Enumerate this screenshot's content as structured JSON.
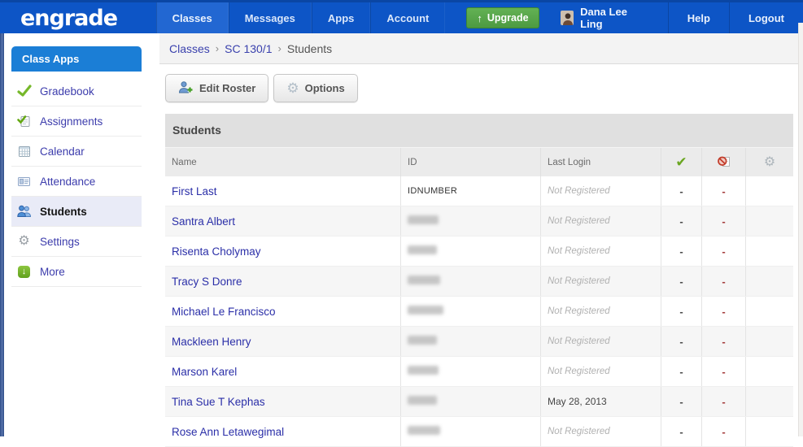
{
  "nav": {
    "logo": "engrade",
    "items": [
      {
        "label": "Classes",
        "active": true
      },
      {
        "label": "Messages",
        "active": false
      },
      {
        "label": "Apps",
        "active": false
      },
      {
        "label": "Account",
        "active": false
      }
    ],
    "upgrade_label": "Upgrade",
    "user_name": "Dana Lee Ling",
    "help_label": "Help",
    "logout_label": "Logout"
  },
  "sidebar": {
    "header": "Class Apps",
    "items": [
      {
        "label": "Gradebook",
        "icon": "gradebook-check-icon",
        "active": false
      },
      {
        "label": "Assignments",
        "icon": "assignments-icon",
        "active": false
      },
      {
        "label": "Calendar",
        "icon": "calendar-icon",
        "active": false
      },
      {
        "label": "Attendance",
        "icon": "attendance-icon",
        "active": false
      },
      {
        "label": "Students",
        "icon": "students-icon",
        "active": true
      },
      {
        "label": "Settings",
        "icon": "settings-gear-icon",
        "active": false
      },
      {
        "label": "More",
        "icon": "more-icon",
        "active": false
      }
    ]
  },
  "breadcrumb": {
    "separator": "›",
    "items": [
      {
        "label": "Classes",
        "link": true
      },
      {
        "label": "SC 130/1",
        "link": true
      },
      {
        "label": "Students",
        "link": false
      }
    ]
  },
  "toolbar": {
    "edit_roster_label": "Edit Roster",
    "options_label": "Options",
    "edit_roster_icon": "person-add-icon",
    "options_icon": "gear-icon"
  },
  "table": {
    "title": "Students",
    "columns": [
      "Name",
      "ID",
      "Last Login"
    ],
    "icon_columns": [
      "check-icon",
      "ban-icon",
      "gear-icon"
    ],
    "dash": "-",
    "rows": [
      {
        "name": "First Last",
        "id": "IDNUMBER",
        "id_redacted": false,
        "id_blur_width": 0,
        "last_login": "Not Registered",
        "registered": false,
        "present": "-",
        "absent": "-"
      },
      {
        "name": "Santra Albert",
        "id": "",
        "id_redacted": true,
        "id_blur_width": 38,
        "last_login": "Not Registered",
        "registered": false,
        "present": "-",
        "absent": "-"
      },
      {
        "name": "Risenta Cholymay",
        "id": "",
        "id_redacted": true,
        "id_blur_width": 36,
        "last_login": "Not Registered",
        "registered": false,
        "present": "-",
        "absent": "-"
      },
      {
        "name": "Tracy S Donre",
        "id": "",
        "id_redacted": true,
        "id_blur_width": 40,
        "last_login": "Not Registered",
        "registered": false,
        "present": "-",
        "absent": "-"
      },
      {
        "name": "Michael Le Francisco",
        "id": "",
        "id_redacted": true,
        "id_blur_width": 44,
        "last_login": "Not Registered",
        "registered": false,
        "present": "-",
        "absent": "-"
      },
      {
        "name": "Mackleen Henry",
        "id": "",
        "id_redacted": true,
        "id_blur_width": 36,
        "last_login": "Not Registered",
        "registered": false,
        "present": "-",
        "absent": "-"
      },
      {
        "name": "Marson Karel",
        "id": "",
        "id_redacted": true,
        "id_blur_width": 38,
        "last_login": "Not Registered",
        "registered": false,
        "present": "-",
        "absent": "-"
      },
      {
        "name": "Tina Sue T Kephas",
        "id": "",
        "id_redacted": true,
        "id_blur_width": 36,
        "last_login": "May 28, 2013",
        "registered": true,
        "present": "-",
        "absent": "-"
      },
      {
        "name": "Rose Ann Letawegimal",
        "id": "",
        "id_redacted": true,
        "id_blur_width": 40,
        "last_login": "Not Registered",
        "registered": false,
        "present": "-",
        "absent": "-"
      }
    ]
  },
  "colors": {
    "nav_blue": "#0d55c6",
    "sidebar_header_blue": "#1b7ed6",
    "upgrade_green": "#55a548",
    "link_indigo": "#2b2fa8",
    "title_bar_gray": "#e0e0e0",
    "header_row_gray": "#ebebeb",
    "absent_dash_red": "#a43c3c"
  }
}
